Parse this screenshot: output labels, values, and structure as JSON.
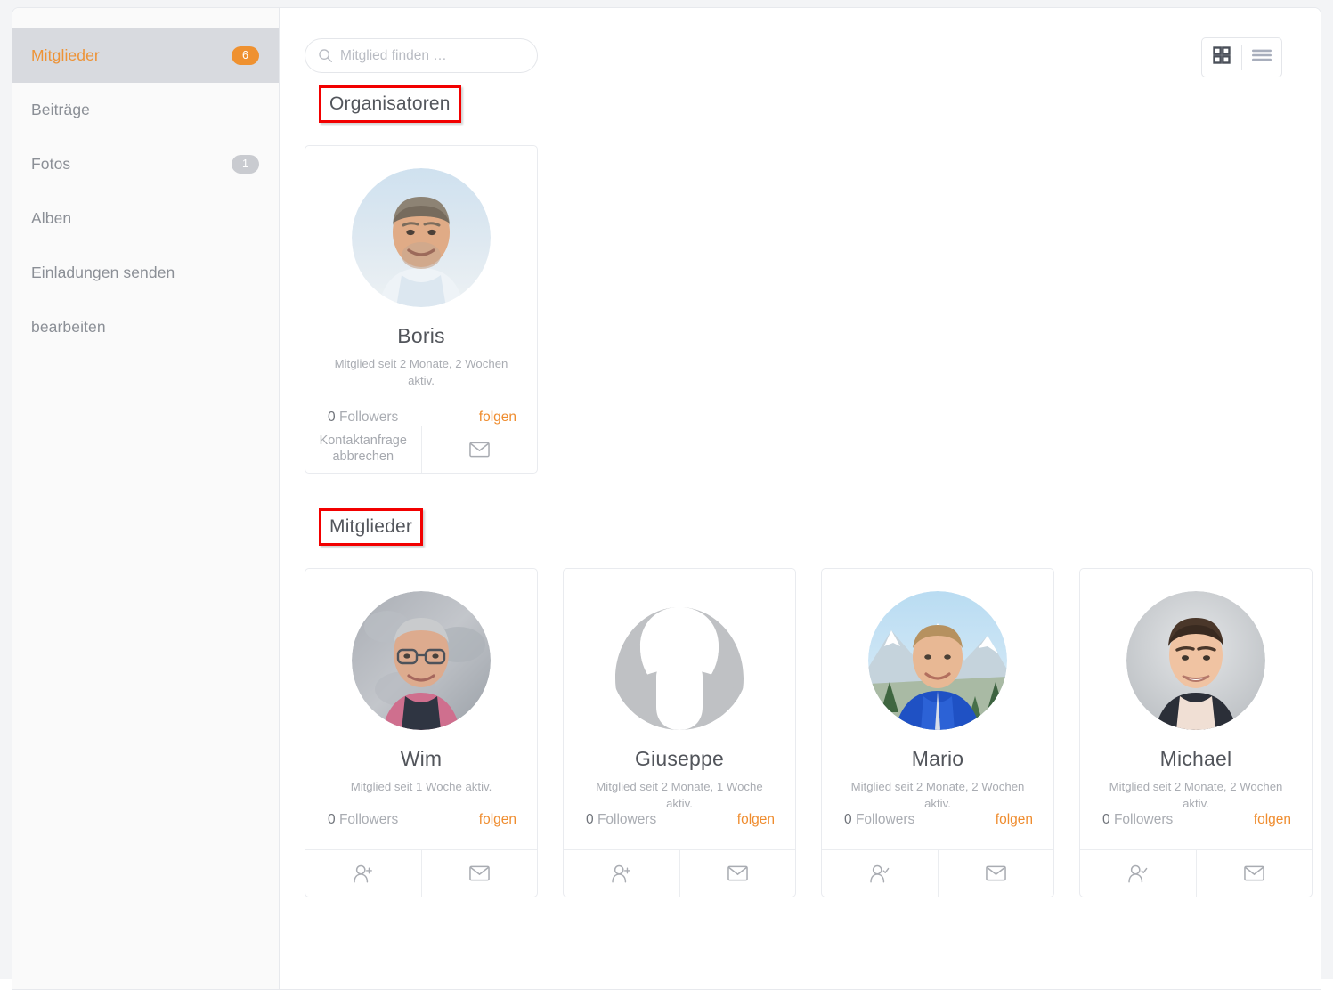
{
  "sidebar": {
    "items": [
      {
        "label": "Mitglieder",
        "badge": "6",
        "active": true,
        "badge_accent": true
      },
      {
        "label": "Beiträge",
        "badge": "",
        "active": false,
        "badge_accent": false
      },
      {
        "label": "Fotos",
        "badge": "1",
        "active": false,
        "badge_accent": false
      },
      {
        "label": "Alben",
        "badge": "",
        "active": false,
        "badge_accent": false
      },
      {
        "label": "Einladungen senden",
        "badge": "",
        "active": false,
        "badge_accent": false
      },
      {
        "label": "bearbeiten",
        "badge": "",
        "active": false,
        "badge_accent": false
      }
    ]
  },
  "toolbar": {
    "search_placeholder": "Mitglied finden …",
    "search_value": "",
    "grid_view_label": "grid-view",
    "list_view_label": "list-view",
    "active_view": "grid"
  },
  "sections": {
    "organizers": {
      "title": "Organisatoren",
      "annotated": true,
      "members": [
        {
          "name": "Boris",
          "meta": "Mitglied seit 2 Monate, 2 Wochen aktiv.",
          "followers": "0",
          "followers_label": "Followers",
          "follow_label": "folgen",
          "avatar": "photo-boris",
          "actions": [
            {
              "type": "text",
              "label": "Kontaktanfrage abbrechen",
              "name": "cancel-contact-request-button"
            },
            {
              "type": "icon",
              "label": "envelope-icon",
              "name": "send-message-button"
            }
          ]
        }
      ]
    },
    "members": {
      "title": "Mitglieder",
      "annotated": true,
      "members": [
        {
          "name": "Wim",
          "meta": "Mitglied seit 1 Woche aktiv.",
          "followers": "0",
          "followers_label": "Followers",
          "follow_label": "folgen",
          "avatar": "photo-wim",
          "meta_lines": 1,
          "actions": [
            {
              "type": "icon",
              "label": "user-plus-icon",
              "name": "add-contact-button"
            },
            {
              "type": "icon",
              "label": "envelope-icon",
              "name": "send-message-button"
            }
          ]
        },
        {
          "name": "Giuseppe",
          "meta": "Mitglied seit 2 Monate, 1 Woche aktiv.",
          "followers": "0",
          "followers_label": "Followers",
          "follow_label": "folgen",
          "avatar": "placeholder-silhouette",
          "meta_lines": 2,
          "actions": [
            {
              "type": "icon",
              "label": "user-plus-icon",
              "name": "add-contact-button"
            },
            {
              "type": "icon",
              "label": "envelope-icon",
              "name": "send-message-button"
            }
          ]
        },
        {
          "name": "Mario",
          "meta": "Mitglied seit 2 Monate, 2 Wochen aktiv.",
          "followers": "0",
          "followers_label": "Followers",
          "follow_label": "folgen",
          "avatar": "photo-mario",
          "meta_lines": 2,
          "actions": [
            {
              "type": "icon",
              "label": "user-check-icon",
              "name": "contact-confirmed-button"
            },
            {
              "type": "icon",
              "label": "envelope-icon",
              "name": "send-message-button"
            }
          ]
        },
        {
          "name": "Michael",
          "meta": "Mitglied seit 2 Monate, 2 Wochen aktiv.",
          "followers": "0",
          "followers_label": "Followers",
          "follow_label": "folgen",
          "avatar": "photo-michael",
          "meta_lines": 2,
          "actions": [
            {
              "type": "icon",
              "label": "user-check-icon",
              "name": "contact-confirmed-button"
            },
            {
              "type": "icon",
              "label": "envelope-icon",
              "name": "send-message-button"
            }
          ]
        }
      ]
    }
  },
  "colors": {
    "accent": "#ef8c2e",
    "badge_accent": "#ef9130",
    "badge_muted": "#c9cbd0",
    "annotation": "#f20000",
    "text_dark": "#52555b",
    "text_muted": "#a9acb2",
    "sidebar_active_bg": "#d8dadf"
  }
}
